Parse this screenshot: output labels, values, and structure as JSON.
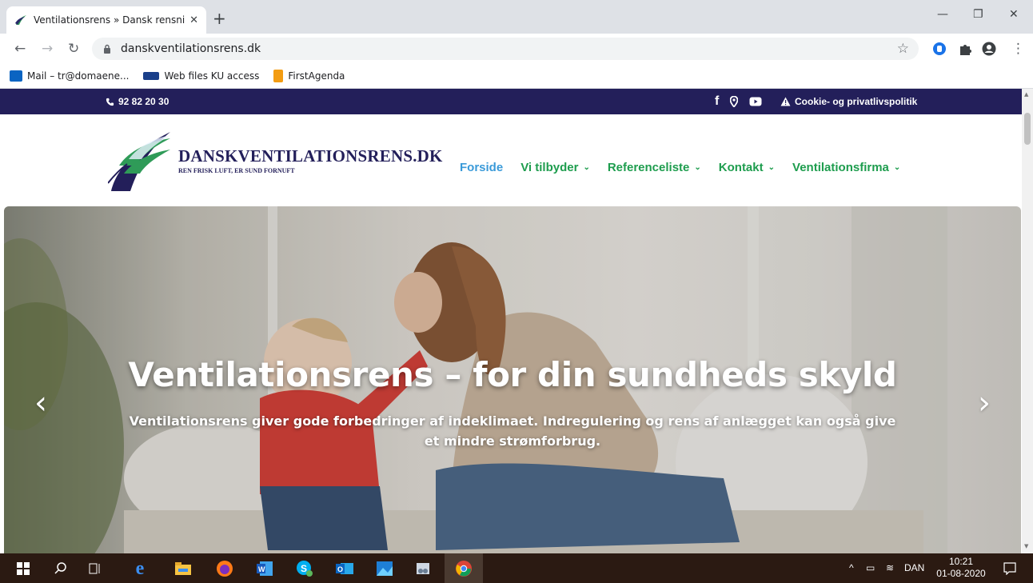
{
  "browser": {
    "tab_title": "Ventilationsrens » Dansk rensning",
    "tab_close": "✕",
    "new_tab": "+",
    "url": "danskventilationsrens.dk",
    "bookmarks": [
      {
        "label": "Mail – tr@domaene...",
        "icon": "outlook-icon",
        "color": "#0a64c2"
      },
      {
        "label": "Web files KU access",
        "icon": "ku-icon",
        "color": "#1a3f8a"
      },
      {
        "label": "FirstAgenda",
        "icon": "firstagenda-icon",
        "color": "#f39c12"
      }
    ]
  },
  "site": {
    "phone": "92 82 20 30",
    "cookie_link": "Cookie- og privatlivspolitik",
    "brand": "DANSKVENTILATIONSRENS.DK",
    "tagline": "REN FRISK LUFT, ER SUND FORNUFT",
    "menu": [
      {
        "label": "Forside",
        "active": true
      },
      {
        "label": "Vi tilbyder",
        "dropdown": true
      },
      {
        "label": "Referenceliste",
        "dropdown": true
      },
      {
        "label": "Kontakt",
        "dropdown": true
      },
      {
        "label": "Ventilationsfirma",
        "dropdown": true
      }
    ],
    "hero": {
      "title": "Ventilationsrens – for din sundheds skyld",
      "subtitle": "Ventilationsrens giver gode forbedringer af indeklimaet. Indregulering og rens af anlægget kan også give et mindre strømforbrug."
    },
    "colors": {
      "topbar": "#231f5a",
      "menu_green": "#1e9d4e",
      "menu_active": "#3a9ad9"
    }
  },
  "taskbar": {
    "language": "DAN",
    "time": "10:21",
    "date": "01-08-2020"
  }
}
